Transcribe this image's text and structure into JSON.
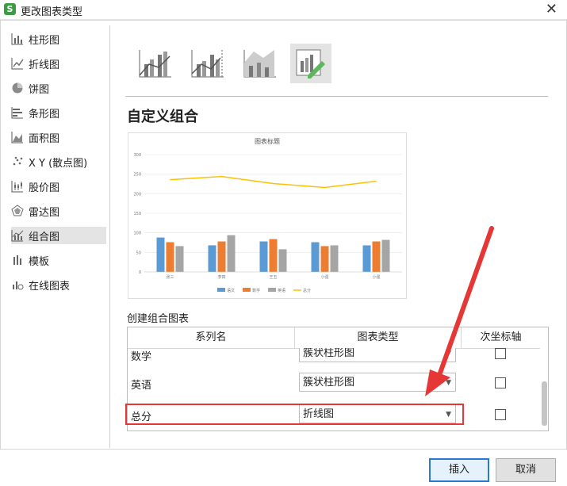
{
  "window": {
    "title": "更改图表类型",
    "app_icon_letter": "S"
  },
  "sidebar": {
    "items": [
      {
        "label": "柱形图",
        "icon": "column-chart-icon"
      },
      {
        "label": "折线图",
        "icon": "line-chart-icon"
      },
      {
        "label": "饼图",
        "icon": "pie-chart-icon"
      },
      {
        "label": "条形图",
        "icon": "bar-chart-icon"
      },
      {
        "label": "面积图",
        "icon": "area-chart-icon"
      },
      {
        "label": "X Y (散点图)",
        "icon": "scatter-chart-icon"
      },
      {
        "label": "股价图",
        "icon": "stock-chart-icon"
      },
      {
        "label": "雷达图",
        "icon": "radar-chart-icon"
      },
      {
        "label": "组合图",
        "icon": "combo-chart-icon",
        "active": true
      },
      {
        "label": "模板",
        "icon": "template-icon"
      },
      {
        "label": "在线图表",
        "icon": "online-chart-icon"
      }
    ]
  },
  "combo_types": [
    "cluster-column-line",
    "cluster-column-line-secondary",
    "stacked-area-cluster-column",
    "custom-combo"
  ],
  "section_title": "自定义组合",
  "chart_data": {
    "type": "bar",
    "title": "图表标题",
    "categories": [
      "张三",
      "李四",
      "王五",
      "小强",
      "小强"
    ],
    "series": [
      {
        "name": "语文",
        "values": [
          88,
          68,
          78,
          76,
          68
        ],
        "color": "#5b9bd5"
      },
      {
        "name": "数学",
        "values": [
          76,
          78,
          84,
          66,
          78
        ],
        "color": "#ed7d31"
      },
      {
        "name": "英语",
        "values": [
          66,
          94,
          58,
          68,
          82
        ],
        "color": "#a5a5a5"
      },
      {
        "name": "总分",
        "values": [
          236,
          244,
          226,
          216,
          232
        ],
        "color": "#ffc000",
        "type": "line"
      }
    ],
    "yticks": [
      "0",
      "50",
      "100",
      "150",
      "200",
      "250",
      "300"
    ],
    "ylim": [
      0,
      300
    ],
    "legend": "bottom"
  },
  "combo_section_label": "创建组合图表",
  "grid": {
    "headers": [
      "系列名",
      "图表类型",
      "次坐标轴"
    ],
    "rows": [
      {
        "name": "数学",
        "type": "簇状柱形图",
        "secondary": false
      },
      {
        "name": "英语",
        "type": "簇状柱形图",
        "secondary": false
      },
      {
        "name": "总分",
        "type": "折线图",
        "secondary": false
      }
    ]
  },
  "buttons": {
    "insert": "插入",
    "cancel": "取消"
  },
  "colors": {
    "highlight": "#e63737",
    "accent": "#2b78d0"
  }
}
